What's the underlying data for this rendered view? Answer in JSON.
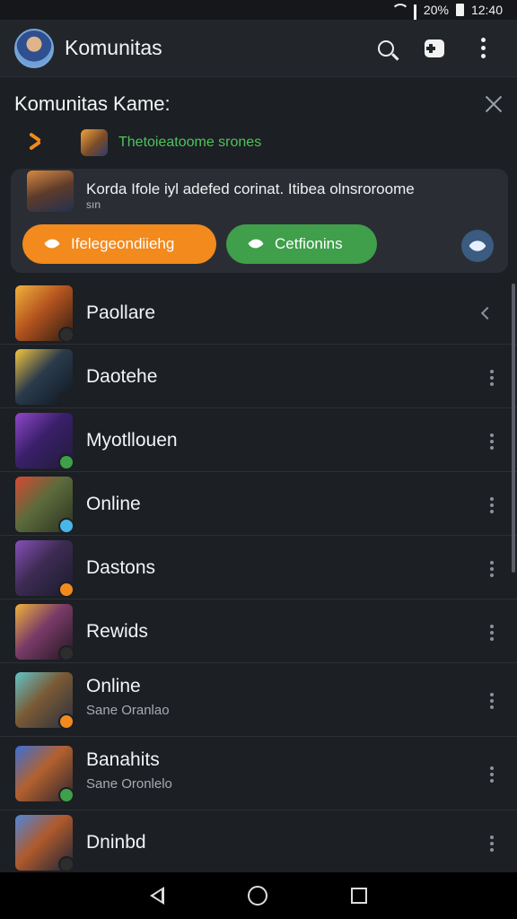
{
  "status": {
    "signal": "20%",
    "battery_label": "▮",
    "time": "12:40"
  },
  "appbar": {
    "title": "Komunitas",
    "icons": [
      "avatar",
      "search-icon",
      "gamepad-icon",
      "more-vert-icon"
    ]
  },
  "section": {
    "title": "Komunitas Kame:",
    "close_icon": "close-icon"
  },
  "subrow": {
    "text": "Thetoieatoome srones"
  },
  "card": {
    "text": "Korda Ifole iyl adefed corinat. Itibea olnsroroome",
    "sub": "sın",
    "button_primary": "Ifelegeondiiehg",
    "button_secondary": "Cetfionins",
    "colors": {
      "primary": "#f28a1d",
      "secondary": "#3f9f4a"
    }
  },
  "list": [
    {
      "name": "Paollare",
      "sub": "",
      "action": "chevron-left-icon",
      "bg": "linear-gradient(135deg,#f0b23a,#b5541f 45%,#2b1b12)",
      "badge": "#2d2d2d"
    },
    {
      "name": "Daotehe",
      "sub": "",
      "action": "more-vert-icon",
      "bg": "linear-gradient(135deg,#f3c640,#2a3b4c 45%,#0f1620)",
      "badge": "#1c1f24"
    },
    {
      "name": "Myotllouen",
      "sub": "",
      "action": "more-vert-icon",
      "bg": "linear-gradient(135deg,#8f48c8,#3a1f6b 45%,#201c38)",
      "badge": "#3f9f4a"
    },
    {
      "name": "Online",
      "sub": "",
      "action": "more-vert-icon",
      "bg": "linear-gradient(135deg,#d64a33,#5c6b3c 45%,#2a3220)",
      "badge": "#49b6e8"
    },
    {
      "name": "Dastons",
      "sub": "",
      "action": "more-vert-icon",
      "bg": "linear-gradient(135deg,#8650b8,#3d2b52 45%,#1a1b2c)",
      "badge": "#f28a1d"
    },
    {
      "name": "Rewids",
      "sub": "",
      "action": "more-vert-icon",
      "bg": "linear-gradient(135deg,#f0b23a,#7a3b68 45%,#221720)",
      "badge": "#2d2d2d"
    },
    {
      "name": "Online",
      "sub": "Sane Oranlao",
      "action": "more-vert-icon",
      "bg": "linear-gradient(135deg,#61c3c8,#7a5a34 45%,#2a3040)",
      "badge": "#f28a1d"
    },
    {
      "name": "Banahits",
      "sub": "Sane Oronlelo",
      "action": "more-vert-icon",
      "bg": "linear-gradient(135deg,#3a6fd6,#b3612e 45%,#2b2530)",
      "badge": "#3f9f4a"
    },
    {
      "name": "Dninbd",
      "sub": "",
      "action": "more-vert-icon",
      "bg": "linear-gradient(135deg,#4f86d8,#b05a2c 45%,#1e2436)",
      "badge": "#2d2d2d"
    }
  ],
  "navbar": {
    "icons": [
      "back-icon",
      "home-icon",
      "recents-icon"
    ]
  }
}
